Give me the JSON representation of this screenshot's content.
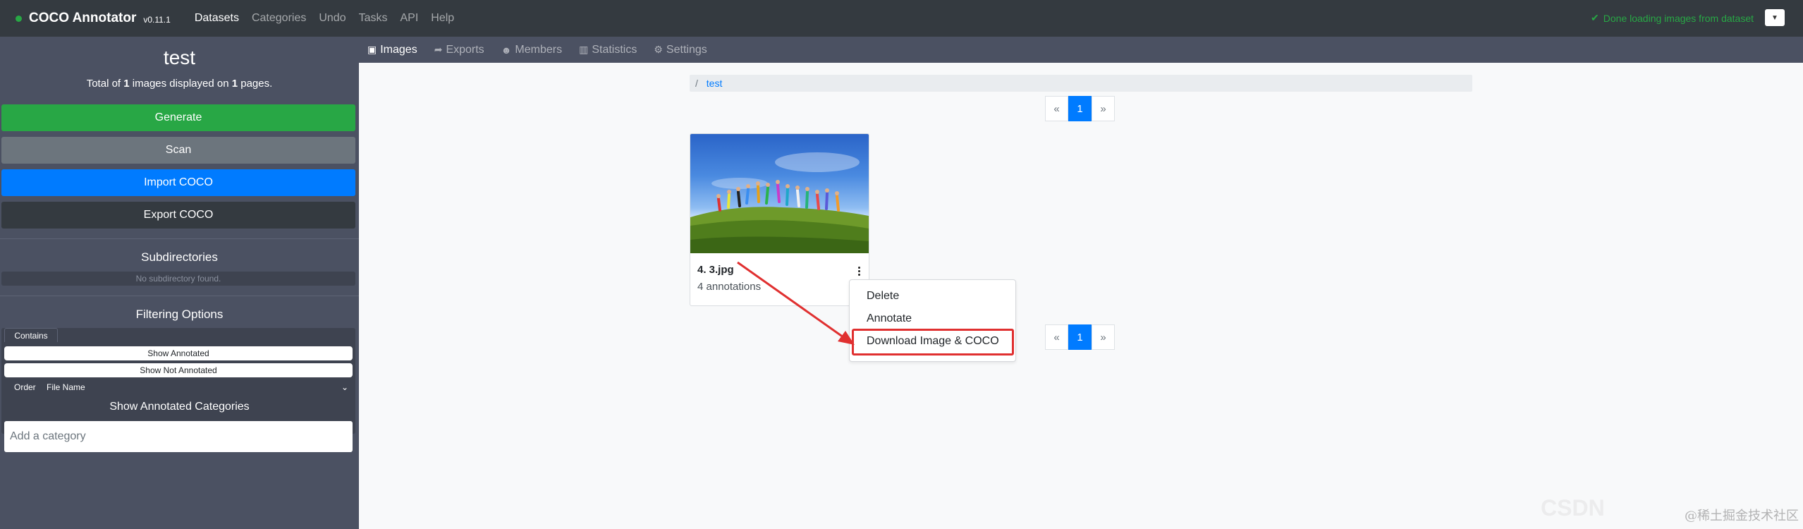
{
  "app": {
    "name": "COCO Annotator",
    "version": "v0.11.1",
    "nav": [
      "Datasets",
      "Categories",
      "Undo",
      "Tasks",
      "API",
      "Help"
    ],
    "status": "Done loading images from dataset"
  },
  "sidebar": {
    "dataset_name": "test",
    "summary": {
      "prefix": "Total of",
      "images": "1",
      "middle": "images displayed on",
      "pages": "1",
      "suffix": "pages."
    },
    "buttons": {
      "generate": "Generate",
      "scan": "Scan",
      "import": "Import COCO",
      "export": "Export COCO"
    },
    "subdirectories": {
      "heading": "Subdirectories",
      "empty": "No subdirectory found."
    },
    "filtering": {
      "heading": "Filtering Options",
      "contains_tab": "Contains",
      "show_annotated": "Show Annotated",
      "show_not_annotated": "Show Not Annotated",
      "order_label": "Order",
      "order_value": "File Name"
    },
    "categories": {
      "heading": "Show Annotated Categories",
      "placeholder": "Add a category"
    }
  },
  "subnav": [
    "Images",
    "Exports",
    "Members",
    "Statistics",
    "Settings"
  ],
  "breadcrumb": {
    "sep": "/",
    "item": "test"
  },
  "pagination": {
    "prev": "«",
    "current": "1",
    "next": "»"
  },
  "image_card": {
    "filename": "4. 3.jpg",
    "annotations": "4 annotations"
  },
  "context_menu": [
    "Delete",
    "Annotate",
    "Download Image & COCO"
  ],
  "watermark": "@稀土掘金技术社区",
  "colors": {
    "navbar": "#343a40",
    "sidebar": "#4b5162",
    "success": "#28a745",
    "primary": "#007bff",
    "highlight": "#e03030"
  }
}
